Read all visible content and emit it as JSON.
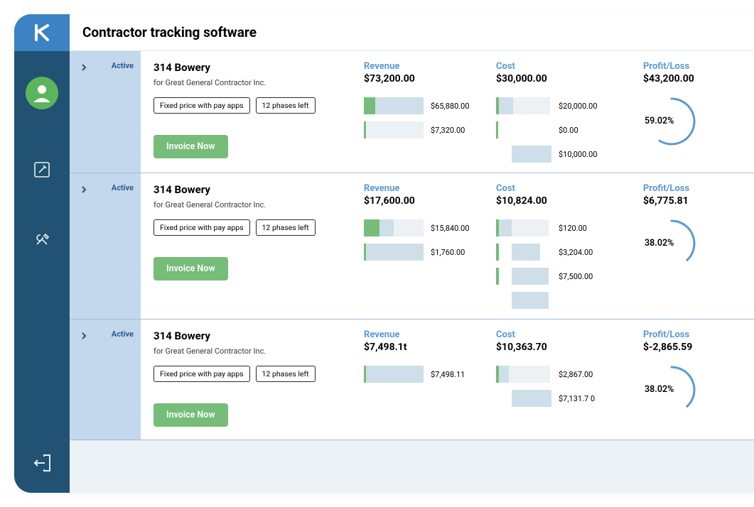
{
  "header": {
    "title": "Contractor tracking software"
  },
  "projects": [
    {
      "status": "Active",
      "name": "314 Bowery",
      "for": "for Great General Contractor Inc.",
      "tag1": "Fixed price with pay apps",
      "tag2": "12 phases left",
      "invoice_btn": "Invoice Now",
      "revenue_label": "Revenue",
      "revenue_amount": "$73,200.00",
      "revenue_bars": [
        {
          "green_w": 16,
          "fill_w": 68,
          "empty_w": 0,
          "value": "$65,880.00"
        },
        {
          "green_w": 3,
          "fill_w": 0,
          "empty_w": 81,
          "value": "$7,320.00"
        }
      ],
      "cost_label": "Cost",
      "cost_amount": "$30,000.00",
      "cost_bars": [
        {
          "green_w": 4,
          "fill_w": 20,
          "empty_w": 52,
          "value": "$20,000.00"
        },
        {
          "green_w": 3,
          "fill_w": 0,
          "empty_w": 0,
          "value": "$0.00"
        },
        {
          "green_w": 0,
          "fill_w": 0,
          "fill2_off": 18,
          "fill2_w": 56,
          "value": "$10,000.00"
        }
      ],
      "profit_label": "Profit/Loss",
      "profit_amount": "$43,200.00",
      "profit_pct": "59.02%",
      "arc_deg": 212
    },
    {
      "status": "Active",
      "name": "314 Bowery",
      "for": "for Great General Contractor Inc.",
      "tag1": "Fixed price with pay apps",
      "tag2": "12 phases left",
      "invoice_btn": "Invoice Now",
      "revenue_label": "Revenue",
      "revenue_amount": "$17,600.00",
      "revenue_bars": [
        {
          "green_w": 22,
          "fill_w": 20,
          "empty_w": 42,
          "value": "$15,840.00"
        },
        {
          "green_w": 3,
          "fill_w": 81,
          "empty_w": 0,
          "value": "$1,760.00"
        }
      ],
      "cost_label": "Cost",
      "cost_amount": "$10,824.00",
      "cost_bars": [
        {
          "green_w": 4,
          "fill_w": 18,
          "empty_w": 52,
          "value": "$120.00"
        },
        {
          "green_w": 4,
          "fill_w": 0,
          "fill2_off": 18,
          "fill2_w": 40,
          "value": "$3,204.00"
        },
        {
          "green_w": 4,
          "fill_w": 0,
          "fill2_off": 18,
          "fill2_w": 52,
          "value": "$7,500.00"
        },
        {
          "green_w": 0,
          "fill_w": 0,
          "fill2_off": 18,
          "fill2_w": 52,
          "value": ""
        }
      ],
      "profit_label": "Profit/Loss",
      "profit_amount": "$6,775.81",
      "profit_pct": "38.02%",
      "arc_deg": 137
    },
    {
      "status": "Active",
      "name": "314 Bowery",
      "for": "for Great General Contractor Inc.",
      "tag1": "Fixed price with pay apps",
      "tag2": "12 phases left",
      "invoice_btn": "Invoice Now",
      "revenue_label": "Revenue",
      "revenue_amount": "$7,498.1t",
      "revenue_bars": [
        {
          "green_w": 3,
          "fill_w": 81,
          "empty_w": 0,
          "value": "$7,498.11"
        }
      ],
      "cost_label": "Cost",
      "cost_amount": "$10,363.70",
      "cost_bars": [
        {
          "green_w": 4,
          "fill_w": 14,
          "empty_w": 58,
          "value": "$2,867.00"
        },
        {
          "green_w": 0,
          "fill_w": 0,
          "fill2_off": 18,
          "fill2_w": 56,
          "value": "$7,131.7 0"
        }
      ],
      "profit_label": "Profit/Loss",
      "profit_amount": "$-2,865.59",
      "profit_pct": "38.02%",
      "arc_deg": 137
    }
  ],
  "chart_data": [
    {
      "type": "bar",
      "title": "314 Bowery — Revenue breakdown",
      "unit": "$",
      "series": [
        {
          "name": "Revenue",
          "values": [
            65880.0,
            7320.0
          ]
        }
      ],
      "total": 73200.0
    },
    {
      "type": "bar",
      "title": "314 Bowery — Cost breakdown",
      "unit": "$",
      "series": [
        {
          "name": "Cost",
          "values": [
            20000.0,
            0.0,
            10000.0
          ]
        }
      ],
      "total": 30000.0
    },
    {
      "type": "bar",
      "title": "314 Bowery (2) — Revenue breakdown",
      "unit": "$",
      "series": [
        {
          "name": "Revenue",
          "values": [
            15840.0,
            1760.0
          ]
        }
      ],
      "total": 17600.0
    },
    {
      "type": "bar",
      "title": "314 Bowery (2) — Cost breakdown",
      "unit": "$",
      "series": [
        {
          "name": "Cost",
          "values": [
            120.0,
            3204.0,
            7500.0
          ]
        }
      ],
      "total": 10824.0
    },
    {
      "type": "bar",
      "title": "314 Bowery (3) — Revenue breakdown",
      "unit": "$",
      "series": [
        {
          "name": "Revenue",
          "values": [
            7498.11
          ]
        }
      ],
      "total": 7498.11
    },
    {
      "type": "bar",
      "title": "314 Bowery (3) — Cost breakdown",
      "unit": "$",
      "series": [
        {
          "name": "Cost",
          "values": [
            2867.0,
            7131.7
          ]
        }
      ],
      "total": 10363.7
    }
  ]
}
